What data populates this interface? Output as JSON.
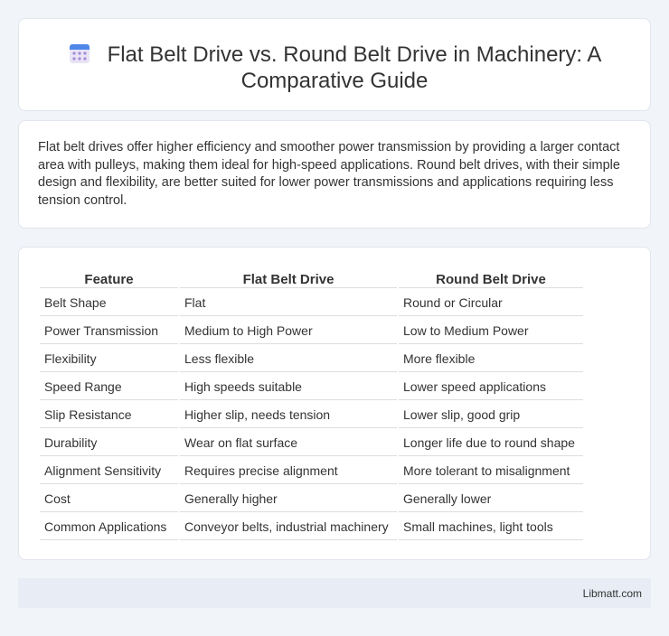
{
  "header": {
    "icon": "calendar-icon",
    "title": "Flat Belt Drive vs. Round Belt Drive in Machinery: A Comparative Guide"
  },
  "intro": {
    "text": "Flat belt drives offer higher efficiency and smoother power transmission by providing a larger contact area with pulleys, making them ideal for high-speed applications. Round belt drives, with their simple design and flexibility, are better suited for lower power transmissions and applications requiring less tension control."
  },
  "table": {
    "headers": [
      "Feature",
      "Flat Belt Drive",
      "Round Belt Drive"
    ],
    "rows": [
      [
        "Belt Shape",
        "Flat",
        "Round or Circular"
      ],
      [
        "Power Transmission",
        "Medium to High Power",
        "Low to Medium Power"
      ],
      [
        "Flexibility",
        "Less flexible",
        "More flexible"
      ],
      [
        "Speed Range",
        "High speeds suitable",
        "Lower speed applications"
      ],
      [
        "Slip Resistance",
        "Higher slip, needs tension",
        "Lower slip, good grip"
      ],
      [
        "Durability",
        "Wear on flat surface",
        "Longer life due to round shape"
      ],
      [
        "Alignment Sensitivity",
        "Requires precise alignment",
        "More tolerant to misalignment"
      ],
      [
        "Cost",
        "Generally higher",
        "Generally lower"
      ],
      [
        "Common Applications",
        "Conveyor belts, industrial machinery",
        "Small machines, light tools"
      ]
    ]
  },
  "footer": {
    "brand": "Libmatt.com"
  }
}
